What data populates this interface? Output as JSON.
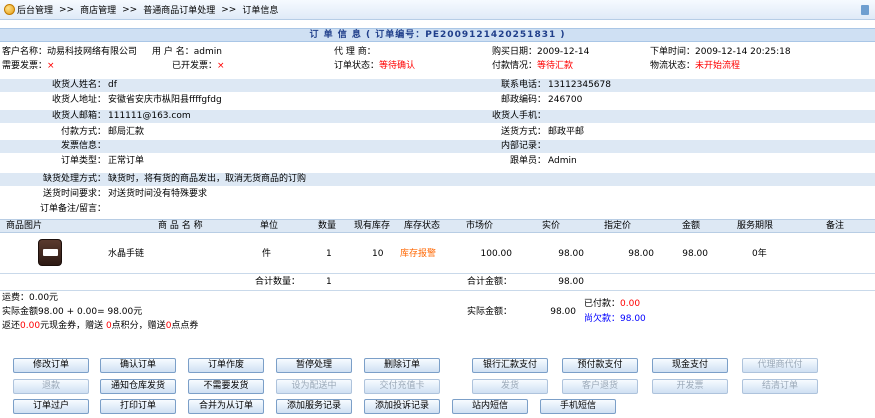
{
  "breadcrumb": [
    "后台管理",
    "商店管理",
    "普通商品订单处理",
    "订单信息"
  ],
  "breadcrumb_sep": ">>",
  "title": "订 单 信 息 ( 订单编号：PE2009121420251831 )",
  "info": {
    "customer_name_label": "客户名称：",
    "customer_name": "动易科技网络有限公司",
    "user_label": "用 户 名：",
    "user": "admin",
    "agent_label": "代 理 商：",
    "agent": "",
    "buy_date_label": "购买日期：",
    "buy_date": "2009-12-14",
    "order_time_label": "下单时间：",
    "order_time": "2009-12-14 20:25:18",
    "need_invoice_label": "需要发票：",
    "need_invoice": "×",
    "invoiced_label": "已开发票：",
    "invoiced": "×",
    "order_status_label": "订单状态：",
    "order_status": "等待确认",
    "payment_status_label": "付款情况：",
    "payment_status": "等待汇款",
    "logistics_label": "物流状态：",
    "logistics": "未开始流程"
  },
  "details": {
    "recv_name_label": "收货人姓名：",
    "recv_name": "df",
    "phone_label": "联系电话：",
    "phone": "13112345678",
    "address_label": "收货人地址：",
    "address": "安徽省安庆市枞阳县ffffgfdg",
    "zip_label": "邮政编码：",
    "zip": "246700",
    "email_label": "收货人邮箱：",
    "email": "111111@163.com",
    "mobile_label": "收货人手机：",
    "mobile": "",
    "pay_method_label": "付款方式：",
    "pay_method": "邮局汇款",
    "ship_method_label": "送货方式：",
    "ship_method": "邮政平邮",
    "invoice_info_label": "发票信息：",
    "invoice_info": "",
    "internal_label": "内部记录：",
    "internal": "",
    "order_type_label": "订单类型：",
    "order_type": "正常订单",
    "follower_label": "跟单员：",
    "follower": "Admin",
    "shortage_label": "缺货处理方式：",
    "shortage": "缺货时，将有货的商品发出，取消无货商品的订购",
    "ship_time_label": "送货时间要求：",
    "ship_time": "对送货时间没有特殊要求",
    "remark_label": "订单备注/留言：",
    "remark": ""
  },
  "table": {
    "headers": [
      "商品图片",
      "商 品 名 称",
      "单位",
      "数量",
      "现有库存",
      "库存状态",
      "市场价",
      "实价",
      "指定价",
      "金额",
      "服务期限",
      "备注"
    ],
    "row": {
      "name": "水晶手链",
      "unit": "件",
      "qty": "1",
      "stock": "10",
      "stock_status": "库存报警",
      "market_price": "100.00",
      "real_price": "98.00",
      "set_price": "98.00",
      "amount": "98.00",
      "service": "0年",
      "note": ""
    },
    "total_qty_label": "合计数量：",
    "total_qty": "1",
    "total_amount_label": "合计金额：",
    "total_amount": "98.00"
  },
  "summary": {
    "freight": "运费：0.00元",
    "actual": "实际金额98.00 + 0.00= 98.00元",
    "rebate_pre": "返还",
    "rebate_amt": "0.00",
    "rebate_mid1": "元现金券，赠送 ",
    "rebate_pts": "0",
    "rebate_mid2": "点积分，赠送",
    "rebate_coupon": "0",
    "rebate_end": "点点券",
    "actual_amount_label": "实际金额：",
    "actual_amount": "98.00",
    "paid_label": "已付款：",
    "paid": "0.00",
    "owed_label": "尚欠款：",
    "owed": "98.00"
  },
  "buttons": {
    "row1": [
      "修改订单",
      "确认订单",
      "订单作废",
      "暂停处理",
      "删除订单",
      "银行汇款支付",
      "预付款支付",
      "现金支付",
      "代理商代付"
    ],
    "row2": [
      "退款",
      "通知仓库发货",
      "不需要发货",
      "设为配送中",
      "交付充值卡",
      "发货",
      "客户退货",
      "开发票",
      "结清订单"
    ],
    "row3": [
      "订单过户",
      "打印订单",
      "合并为从订单",
      "添加服务记录",
      "添加投诉记录",
      "站内短信",
      "手机短信"
    ]
  },
  "colors": {
    "alert": "#ff0000",
    "link_blue": "#0000ff",
    "band": "#dde8f4",
    "title": "#1f3e8a"
  }
}
